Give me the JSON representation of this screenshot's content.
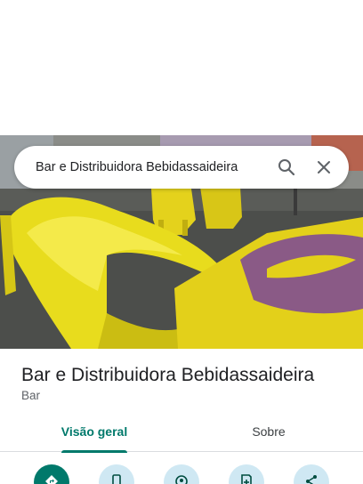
{
  "search": {
    "query": "Bar e Distribuidora Bebidassaideira"
  },
  "place": {
    "name": "Bar e Distribuidora Bebidassaideira",
    "category": "Bar"
  },
  "tabs": [
    {
      "label": "Visão geral",
      "selected": true
    },
    {
      "label": "Sobre",
      "selected": false
    }
  ],
  "actions": [
    {
      "icon": "directions-icon"
    },
    {
      "icon": "phone-icon"
    },
    {
      "icon": "location-share-icon"
    },
    {
      "icon": "save-icon"
    },
    {
      "icon": "share-icon"
    }
  ],
  "colors": {
    "accent": "#00796b",
    "action_bg": "#cfe8f3",
    "text_primary": "#202124",
    "text_secondary": "#5f6368"
  }
}
